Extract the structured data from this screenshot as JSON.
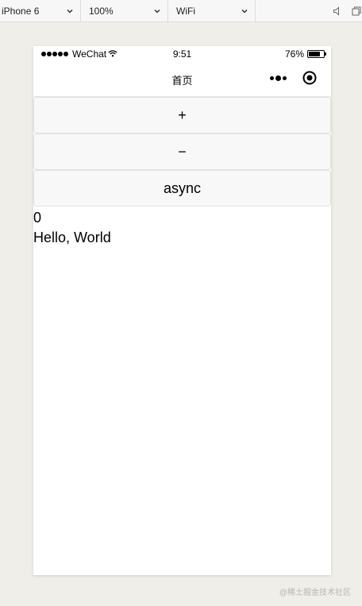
{
  "toolbar": {
    "device": "iPhone 6",
    "zoom": "100%",
    "network": "WiFi",
    "icons": [
      "speaker-icon",
      "window-icon"
    ]
  },
  "status_bar": {
    "carrier": "WeChat",
    "time": "9:51",
    "battery_percent_text": "76%",
    "battery_level": 0.76
  },
  "nav_bar": {
    "title": "首页"
  },
  "buttons": {
    "plus": "+",
    "minus": "−",
    "async": "async"
  },
  "content": {
    "counter": "0",
    "greeting": "Hello, World"
  },
  "watermark": "@稀土掘金技术社区",
  "colors": {
    "workspace_bg": "#efeee9",
    "button_bg": "#f8f8f8",
    "text": "#000000"
  }
}
